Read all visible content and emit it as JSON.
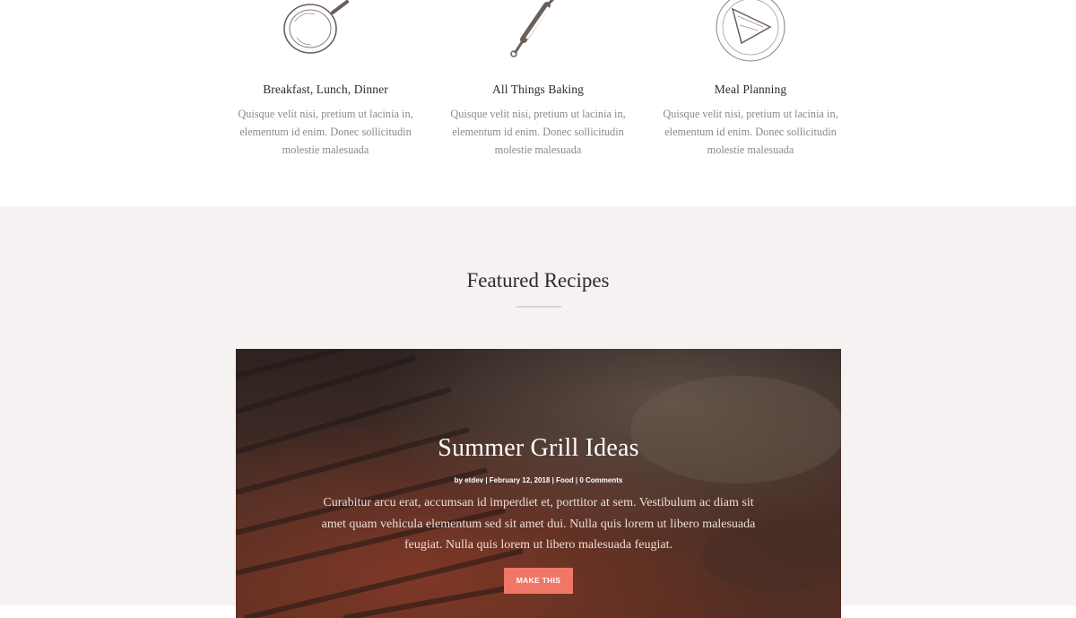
{
  "features": [
    {
      "icon": "frying-pan-icon",
      "title": "Breakfast, Lunch, Dinner",
      "text": "Quisque velit nisi, pretium ut lacinia in, elementum id enim. Donec sollicitudin molestie malesuada"
    },
    {
      "icon": "rolling-pin-icon",
      "title": "All Things Baking",
      "text": "Quisque velit nisi, pretium ut lacinia in, elementum id enim. Donec sollicitudin molestie malesuada"
    },
    {
      "icon": "plate-icon",
      "title": "Meal Planning",
      "text": "Quisque velit nisi, pretium ut lacinia in, elementum id enim. Donec sollicitudin molestie malesuada"
    }
  ],
  "featured": {
    "heading": "Featured Recipes",
    "post": {
      "title": "Summer Grill Ideas",
      "author": "etdev",
      "date": "February 12, 2018",
      "category": "Food",
      "comments": "0 Comments",
      "excerpt": "Curabitur arcu erat, accumsan id imperdiet et, porttitor at sem. Vestibulum ac diam sit amet quam vehicula elementum sed sit amet dui. Nulla quis lorem ut libero malesuada feugiat. Nulla quis lorem ut libero malesuada feugiat.",
      "button": "MAKE THIS"
    }
  },
  "colors": {
    "band_background": "#f7f2f2",
    "button": "#f07766",
    "heading": "#2c2c2c",
    "body_text": "#8a8a8a"
  }
}
